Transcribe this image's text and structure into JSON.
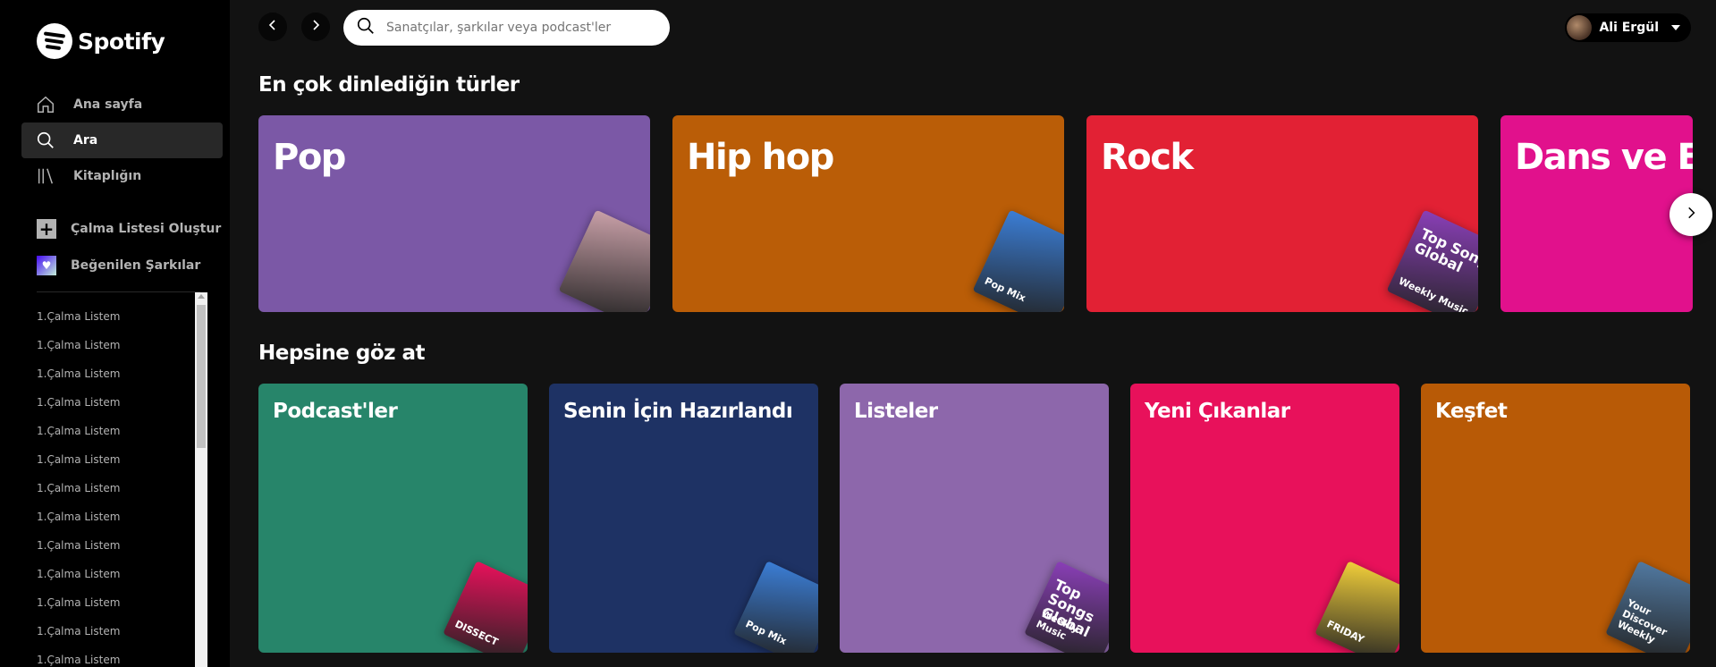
{
  "app": {
    "name": "Spotify"
  },
  "sidebar": {
    "nav": [
      {
        "label": "Ana sayfa",
        "icon": "home-icon"
      },
      {
        "label": "Ara",
        "icon": "search-icon",
        "active": true
      },
      {
        "label": "Kitaplığın",
        "icon": "library-icon"
      }
    ],
    "create_playlist": "Çalma Listesi Oluştur",
    "liked_songs": "Beğenilen Şarkılar",
    "playlists": [
      "1.Çalma Listem",
      "1.Çalma Listem",
      "1.Çalma Listem",
      "1.Çalma Listem",
      "1.Çalma Listem",
      "1.Çalma Listem",
      "1.Çalma Listem",
      "1.Çalma Listem",
      "1.Çalma Listem",
      "1.Çalma Listem",
      "1.Çalma Listem",
      "1.Çalma Listem",
      "1.Çalma Listem"
    ]
  },
  "topbar": {
    "search_placeholder": "Sanatçılar, şarkılar veya podcast'ler",
    "user_name": "Ali Ergül"
  },
  "top_genres": {
    "title": "En çok dinlediğin türler",
    "cards": [
      {
        "label": "Pop",
        "color": "#7b58a6",
        "art_color": "#c9a0a8",
        "art_text": ""
      },
      {
        "label": "Hip hop",
        "color": "#ba5d07",
        "art_color": "#3b7ed6",
        "art_text": "Pop Mix"
      },
      {
        "label": "Rock",
        "color": "#e22134",
        "art_color": "#8a3fb7",
        "art_text": "Weekly Music",
        "art_big": "Top Songs Global"
      },
      {
        "label": "Dans ve Elektronik",
        "color": "#e1118c",
        "art_color": "#e1118c",
        "art_text": ""
      }
    ]
  },
  "browse_all": {
    "title": "Hepsine göz at",
    "cards": [
      {
        "label": "Podcast'ler",
        "color": "#27856a",
        "art_color": "#e8115b",
        "art_text": "DISSECT"
      },
      {
        "label": "Senin İçin Hazırlandı",
        "color": "#1e3264",
        "art_color": "#3b7ed6",
        "art_text": "Pop Mix"
      },
      {
        "label": "Listeler",
        "color": "#8d67ab",
        "art_color": "#8a3fb7",
        "art_text": "Weekly Music",
        "art_big": "Top Songs Global"
      },
      {
        "label": "Yeni Çıkanlar",
        "color": "#e8115b",
        "art_color": "#f2cf3a",
        "art_text": "FRIDAY"
      },
      {
        "label": "Keşfet",
        "color": "#b85a06",
        "art_color": "#5179a1",
        "art_text": "Your Discover Weekly"
      }
    ]
  }
}
